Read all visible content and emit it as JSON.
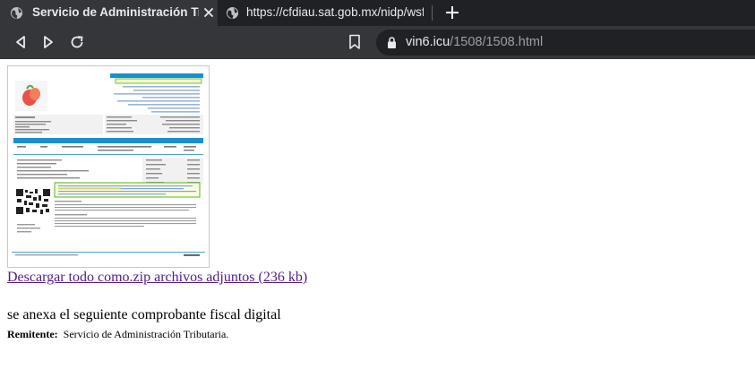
{
  "tabs": [
    {
      "title": "Servicio de Administración Tributaria",
      "active": true
    },
    {
      "title": "https://cfdiau.sat.gob.mx/nidp/wsfed/",
      "active": false
    }
  ],
  "address_bar": {
    "host": "vin6.icu",
    "path": "/1508/1508.html"
  },
  "page": {
    "download_link": "Descargar todo como.zip  archivos adjuntos (236 kb)",
    "message": "se anexa el seguiente comprobante fiscal digital",
    "sender_label": "Remitente:",
    "sender_value": "Servicio de Administración Tributaria."
  },
  "colors": {
    "chrome_dark": "#202124",
    "chrome_tab": "#35363a",
    "link_visited": "#551a8b",
    "invoice_accent": "#1a8fd0",
    "invoice_highlight": "#6dc044"
  },
  "icons": [
    "globe-icon",
    "close-icon",
    "plus-icon",
    "back-icon",
    "forward-icon",
    "reload-icon",
    "bookmark-icon",
    "lock-icon"
  ]
}
